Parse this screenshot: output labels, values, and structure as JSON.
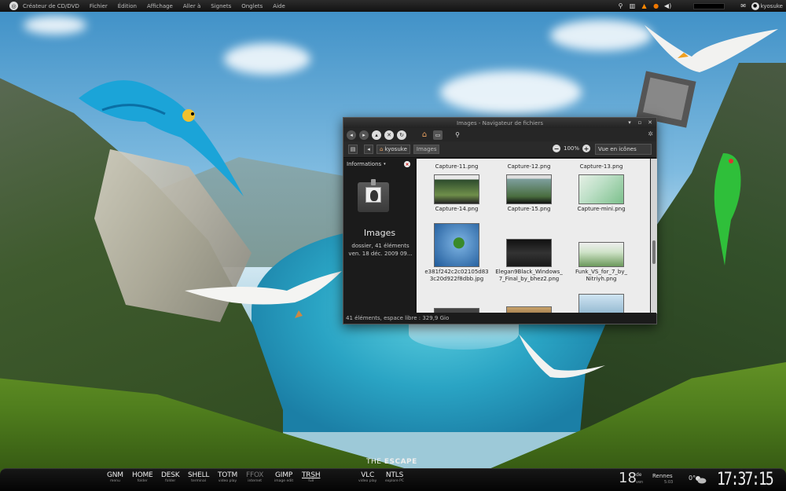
{
  "top_panel": {
    "menu": [
      "Créateur de CD/DVD",
      "Fichier",
      "Édition",
      "Affichage",
      "Aller à",
      "Signets",
      "Onglets",
      "Aide"
    ],
    "user": "kyosuke",
    "icons": [
      "search-icon",
      "trash-icon",
      "vlc-icon",
      "firefox-icon",
      "volume-icon",
      "mail-icon",
      "user-icon"
    ]
  },
  "file_manager": {
    "title": "Images - Navigateur de fichiers",
    "breadcrumb": [
      "kyosuke",
      "Images"
    ],
    "zoom": "100%",
    "view_mode": "Vue en icônes",
    "sidepane": {
      "header": "Informations",
      "folder_name": "Images",
      "line1": "dossier, 41 éléments",
      "line2": "ven. 18 déc. 2009 09..."
    },
    "files": [
      {
        "name1": "Capture-11.png",
        "name2": ""
      },
      {
        "name1": "Capture-12.png",
        "name2": ""
      },
      {
        "name1": "Capture-13.png",
        "name2": ""
      },
      {
        "name1": "Capture-14.png",
        "name2": ""
      },
      {
        "name1": "Capture-15.png",
        "name2": ""
      },
      {
        "name1": "Capture-mini.png",
        "name2": ""
      },
      {
        "name1": "e381f242c2c02105d83",
        "name2": "3c20d922f8dbb.jpg"
      },
      {
        "name1": "Elegan9Black_Windows_",
        "name2": "7_Final_by_bhez2.png"
      },
      {
        "name1": "Funk_VS_for_7_by_",
        "name2": "Nitriyh.png"
      }
    ],
    "status": "41 éléments, espace libre : 329,9 Gio"
  },
  "dock": {
    "title_thin": "THE",
    "title_bold": "ESCAPE",
    "launchers": [
      {
        "name": "GNM",
        "sub": "menu"
      },
      {
        "name": "HOME",
        "sub": "folder"
      },
      {
        "name": "DESK",
        "sub": "folder"
      },
      {
        "name": "SHELL",
        "sub": "terminal"
      },
      {
        "name": "TOTM",
        "sub": "video play"
      },
      {
        "name": "FFOX",
        "sub": "internet"
      },
      {
        "name": "GIMP",
        "sub": "image edit"
      },
      {
        "name": "TRSH",
        "sub": "full"
      },
      {
        "name": "VLC",
        "sub": "video play"
      },
      {
        "name": "NTLS",
        "sub": "explore PC"
      }
    ],
    "date_day": "18",
    "date_suffix": "de",
    "weekday": "ven",
    "city": "Rennes",
    "city_sub": "5:03",
    "temp": "0°",
    "time": "17:37:15"
  },
  "colors": {
    "panel": "#121212",
    "window_bg": "#1e1e1e",
    "icon_view_bg": "#ececec"
  }
}
